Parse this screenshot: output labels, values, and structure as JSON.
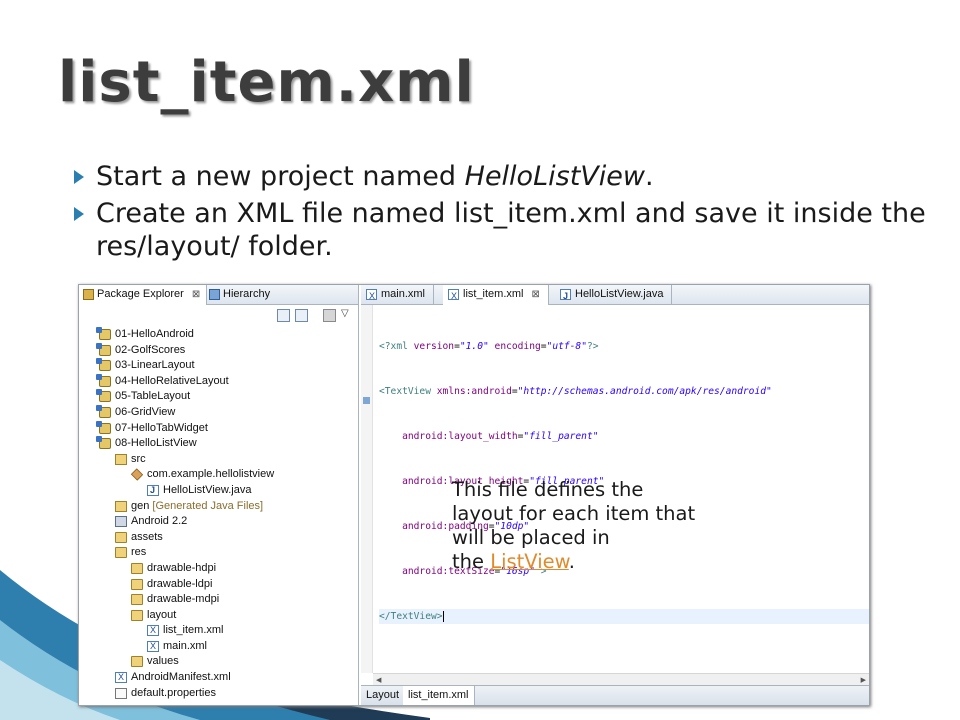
{
  "slide": {
    "title": "list_item.xml",
    "bullets": [
      {
        "before": "Start a new project named ",
        "emph": "HelloListView",
        "after": "."
      },
      {
        "before": "Create an XML file named list_item.xml and save it inside the res/layout/ folder.",
        "emph": "",
        "after": ""
      }
    ],
    "note": {
      "line1": "This file defines the",
      "line2": "layout for each item that",
      "line3": "will be placed in",
      "line4_prefix": "the ",
      "link_text": "ListView",
      "line4_suffix": "."
    }
  },
  "package_explorer": {
    "tabs": [
      {
        "label": "Package Explorer",
        "close": "⊠"
      },
      {
        "label": "Hierarchy"
      }
    ],
    "tree": [
      {
        "label": "01-HelloAndroid",
        "icon": "project-icon",
        "depth": 0
      },
      {
        "label": "02-GolfScores",
        "icon": "project-icon",
        "depth": 0
      },
      {
        "label": "03-LinearLayout",
        "icon": "project-icon",
        "depth": 0
      },
      {
        "label": "04-HelloRelativeLayout",
        "icon": "project-icon",
        "depth": 0
      },
      {
        "label": "05-TableLayout",
        "icon": "project-icon",
        "depth": 0
      },
      {
        "label": "06-GridView",
        "icon": "project-icon",
        "depth": 0
      },
      {
        "label": "07-HelloTabWidget",
        "icon": "project-icon",
        "depth": 0
      },
      {
        "label": "08-HelloListView",
        "icon": "project-icon",
        "depth": 0
      },
      {
        "label": "src",
        "icon": "source-folder-icon",
        "depth": 1
      },
      {
        "label": "com.example.hellolistview",
        "icon": "package-icon",
        "depth": 2
      },
      {
        "label": "HelloListView.java",
        "icon": "java-file-icon",
        "depth": 3
      },
      {
        "label": "gen",
        "decoration": "[Generated Java Files]",
        "icon": "source-folder-icon",
        "depth": 1
      },
      {
        "label": "Android 2.2",
        "icon": "library-icon",
        "depth": 1
      },
      {
        "label": "assets",
        "icon": "folder-icon",
        "depth": 1
      },
      {
        "label": "res",
        "icon": "folder-icon",
        "depth": 1
      },
      {
        "label": "drawable-hdpi",
        "icon": "folder-icon",
        "depth": 2
      },
      {
        "label": "drawable-ldpi",
        "icon": "folder-icon",
        "depth": 2
      },
      {
        "label": "drawable-mdpi",
        "icon": "folder-icon",
        "depth": 2
      },
      {
        "label": "layout",
        "icon": "folder-icon",
        "depth": 2
      },
      {
        "label": "list_item.xml",
        "icon": "xml-file-icon",
        "depth": 3
      },
      {
        "label": "main.xml",
        "icon": "xml-file-icon",
        "depth": 3
      },
      {
        "label": "values",
        "icon": "folder-icon",
        "depth": 2
      },
      {
        "label": "AndroidManifest.xml",
        "icon": "xml-file-icon",
        "depth": 1
      },
      {
        "label": "default.properties",
        "icon": "file-icon",
        "depth": 1
      }
    ]
  },
  "editor": {
    "tabs": [
      {
        "label": "main.xml"
      },
      {
        "label": "list_item.xml",
        "close": "⊠",
        "active": true
      },
      {
        "label": "HelloListView.java"
      }
    ],
    "code": {
      "l1_open": "<?xml ",
      "l1_a1": "version",
      "l1_v1": "\"1.0\"",
      "l1_a2": "encoding",
      "l1_v2": "\"utf-8\"",
      "l1_close": "?>",
      "l2_tag": "<TextView ",
      "l2_attr": "xmlns:android",
      "l2_val": "\"http://schemas.android.com/apk/res/android\"",
      "l3_attr": "android:layout_width",
      "l3_val": "\"fill_parent\"",
      "l4_attr": "android:layout_height",
      "l4_val": "\"fill_parent\"",
      "l5_attr": "android:padding",
      "l5_val": "\"10dp\"",
      "l6_attr": "android:textSize",
      "l6_val": "\"16sp\"",
      "l6_close": " >",
      "l7_tag": "</TextView>"
    },
    "bottom_tabs": [
      {
        "label": "Layout"
      },
      {
        "label": "list_item.xml",
        "active": true
      }
    ]
  },
  "colors": {
    "accent": "#2b7fb0",
    "link": "#e08a2c",
    "title": "#3d3d3d"
  }
}
